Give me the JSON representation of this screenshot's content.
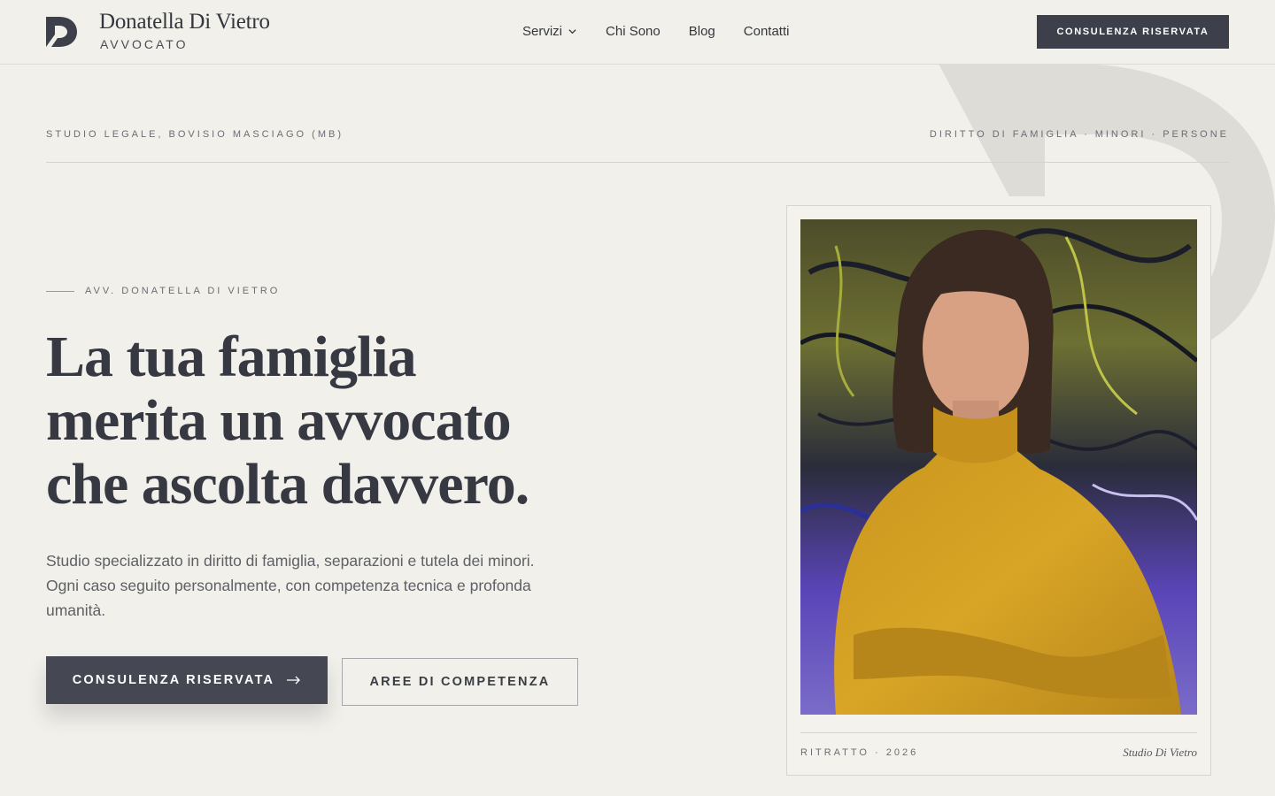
{
  "header": {
    "brand_name": "Donatella Di Vietro",
    "brand_sub": "AVVOCATO",
    "nav": [
      {
        "label": "Servizi",
        "has_dropdown": true
      },
      {
        "label": "Chi Sono"
      },
      {
        "label": "Blog"
      },
      {
        "label": "Contatti"
      }
    ],
    "cta_label": "CONSULENZA RISERVATA"
  },
  "meta": {
    "left": "STUDIO LEGALE, BOVISIO MASCIAGO (MB)",
    "right": "DIRITTO DI FAMIGLIA · MINORI · PERSONE"
  },
  "hero": {
    "eyebrow": "AVV. DONATELLA DI VIETRO",
    "headline": [
      "La tua famiglia",
      "merita un avvocato",
      "che ascolta davvero."
    ],
    "lead": "Studio specializzato in diritto di famiglia, separazioni e tutela dei minori. Ogni caso seguito personalmente, con competenza tecnica e profonda umanità.",
    "primary_cta": "CONSULENZA RISERVATA",
    "secondary_cta": "AREE DI COMPETENZA"
  },
  "portrait_card": {
    "caption": "RITRATTO · 2026",
    "signature": "Studio Di Vietro"
  },
  "colors": {
    "background": "#f1f0ea",
    "ink": "#3b3d45",
    "button_dark": "#454853",
    "muted": "#6b6d72"
  }
}
